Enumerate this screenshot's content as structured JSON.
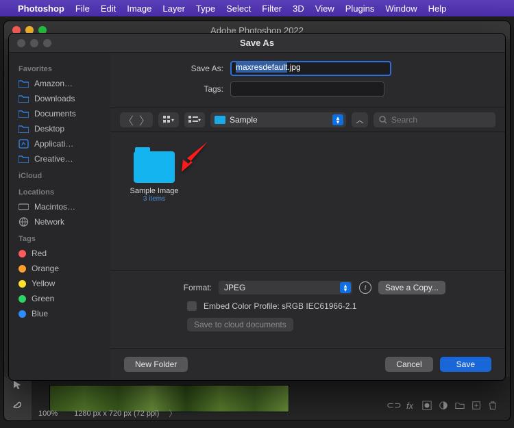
{
  "menubar": {
    "app": "Photoshop",
    "items": [
      "File",
      "Edit",
      "Image",
      "Layer",
      "Type",
      "Select",
      "Filter",
      "3D",
      "View",
      "Plugins",
      "Window",
      "Help"
    ]
  },
  "appwin": {
    "title": "Adobe Photoshop 2022"
  },
  "dialog": {
    "title": "Save As",
    "saveas_label": "Save As:",
    "filename_sel": "maxresdefault",
    "filename_ext": ".jpg",
    "tags_label": "Tags:",
    "location": "Sample",
    "search_placeholder": "Search",
    "folder": {
      "name": "Sample Image",
      "count": "3 items"
    },
    "format_label": "Format:",
    "format_value": "JPEG",
    "save_copy": "Save a Copy...",
    "embed_label": "Embed Color Profile:  sRGB IEC61966-2.1",
    "cloud_btn": "Save to cloud documents",
    "new_folder": "New Folder",
    "cancel": "Cancel",
    "save": "Save"
  },
  "sidebar": {
    "favorites_head": "Favorites",
    "favorites": [
      "Amazon…",
      "Downloads",
      "Documents",
      "Desktop",
      "Applicati…",
      "Creative…"
    ],
    "icloud_head": "iCloud",
    "locations_head": "Locations",
    "locations": [
      "Macintos…",
      "Network"
    ],
    "tags_head": "Tags",
    "tags": [
      {
        "label": "Red",
        "color": "#ff5b5b"
      },
      {
        "label": "Orange",
        "color": "#ff9d2e"
      },
      {
        "label": "Yellow",
        "color": "#ffe02e"
      },
      {
        "label": "Green",
        "color": "#2ed365"
      },
      {
        "label": "Blue",
        "color": "#2e8cff"
      }
    ]
  },
  "status": {
    "zoom": "100%",
    "dims": "1280 px x 720 px (72 ppi)"
  },
  "icons": {
    "folder_blue": "folder",
    "hd": "hd",
    "globe": "globe",
    "app": "app"
  }
}
